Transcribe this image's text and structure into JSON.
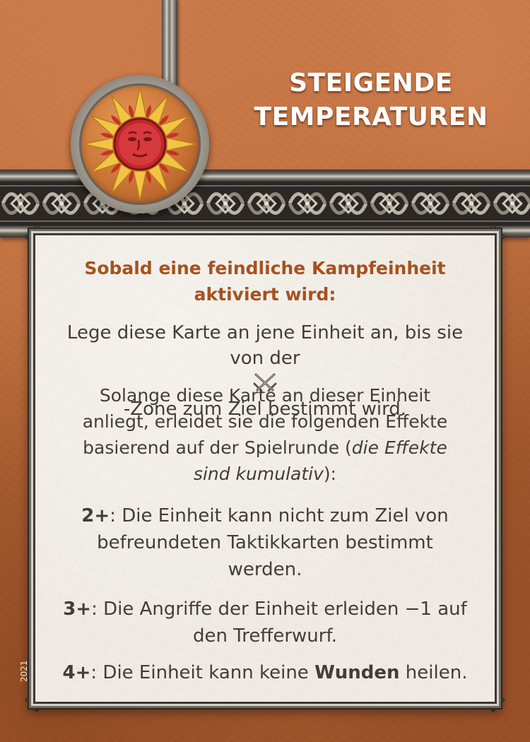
{
  "card": {
    "title_line1": "STEIGENDE",
    "title_line2": "TEMPERATUREN",
    "emblem": "sun-face-icon",
    "trigger_line1": "Sobald eine feindliche Kampfeinheit",
    "trigger_line2": "aktiviert wird:",
    "p1_line1": "Lege diese Karte an jene Einheit an, bis sie",
    "p1_pre": "von der",
    "p1_icon": "crossed-swords-icon",
    "p1_post": "-Zone zum Ziel bestimmt wird.",
    "p2_line1": "Solange diese Karte an dieser Einheit",
    "p2_line2": "anliegt, erleidet sie die folgenden Effekte",
    "p2_line3_pre": "basierend auf der Spielrunde (",
    "p2_line3_italic": "die Effekte",
    "p2_line4_italic": "sind kumulativ",
    "p2_line4_post": "):",
    "p3_label": "2+",
    "p3_line1": ": Die Einheit kann nicht zum Ziel von",
    "p3_line2": "befreundeten Taktikkarten bestimmt",
    "p3_line3": "werden.",
    "p4_label": "3+",
    "p4_line1": ": Die Angriffe der Einheit erleiden −1 auf",
    "p4_line2": "den Trefferwurf.",
    "p5_label": "4+",
    "p5_pre": ": Die Einheit kann keine ",
    "p5_bold": "Wunden",
    "p5_post": " heilen.",
    "year": "2021"
  },
  "colors": {
    "trigger_text": "#a5521f",
    "body_text": "#453c33",
    "title_text": "#ffffff",
    "background": "#b86838",
    "panel": "#efebe4"
  }
}
